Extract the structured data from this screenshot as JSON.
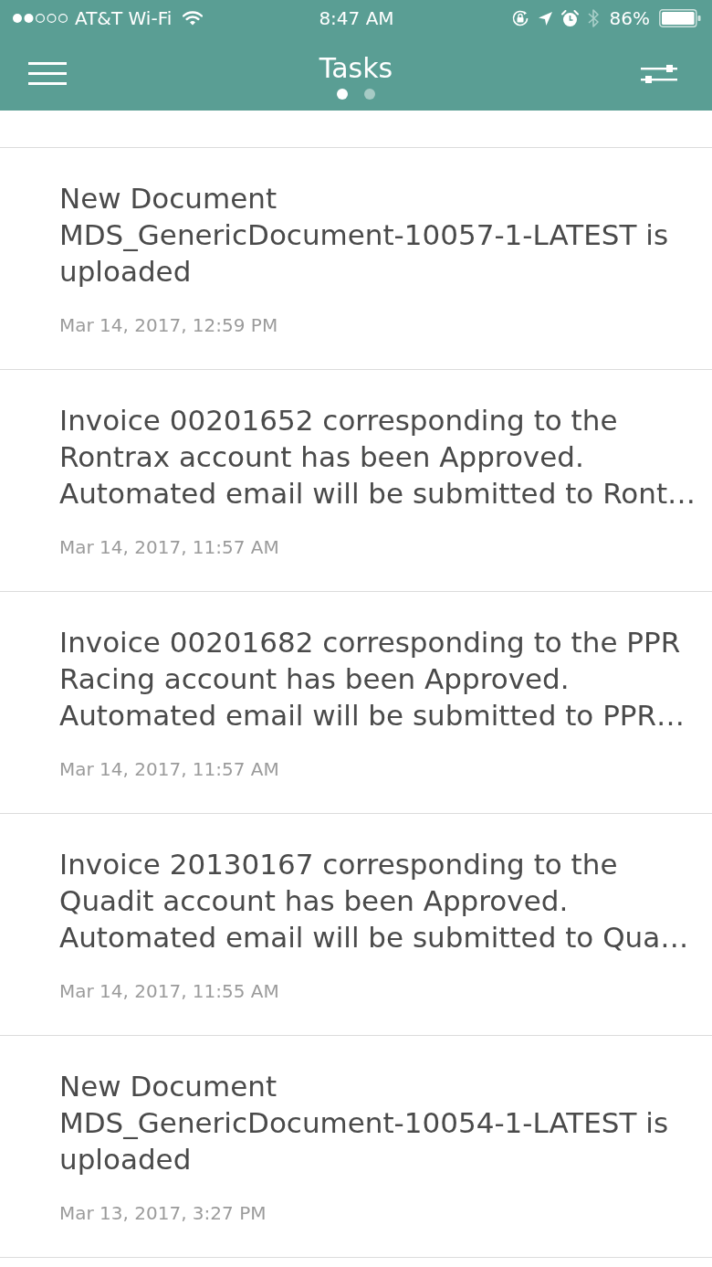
{
  "status_bar": {
    "carrier": "AT&T Wi-Fi",
    "time": "8:47 AM",
    "battery": "86%"
  },
  "nav": {
    "title": "Tasks",
    "pages": [
      {
        "selected": true
      },
      {
        "selected": false
      }
    ]
  },
  "tasks": [
    {
      "title": "New Document MDS_GenericDocument-10057-1-LATEST is uploaded",
      "time": "Mar 14, 2017, 12:59 PM"
    },
    {
      "title": "Invoice 00201652 corresponding to the Rontrax account has been Approved. Automated email will be submitted to Ront…",
      "time": "Mar 14, 2017, 11:57 AM"
    },
    {
      "title": "Invoice 00201682 corresponding to the PPR Racing account has been Approved. Automated email will be submitted to PPR…",
      "time": "Mar 14, 2017, 11:57 AM"
    },
    {
      "title": "Invoice 20130167 corresponding to the Quadit account has been Approved. Automated email will be submitted to Qua…",
      "time": "Mar 14, 2017, 11:55 AM"
    },
    {
      "title": "New Document MDS_GenericDocument-10054-1-LATEST is uploaded",
      "time": "Mar 13, 2017, 3:27 PM"
    }
  ]
}
